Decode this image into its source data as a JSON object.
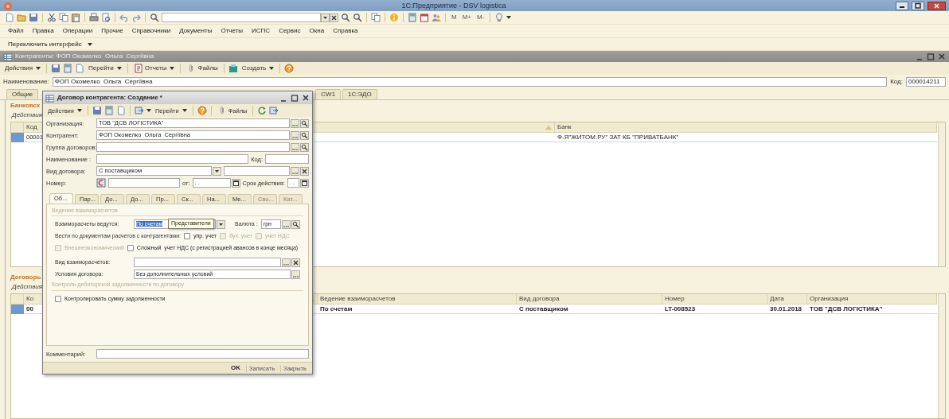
{
  "app_window": {
    "title": "1С:Предприятие - DSV logistica"
  },
  "memory_buttons": [
    "M",
    "M+",
    "M-"
  ],
  "menu": [
    "Файл",
    "Правка",
    "Операции",
    "Прочие",
    "Справочники",
    "Документы",
    "Отчеты",
    "ИСПС",
    "Сервис",
    "Окна",
    "Справка"
  ],
  "switch_interface": "Переключить интерфейс",
  "counterparty_window": {
    "title": "Контрагенты: ФОП Окомелко  Ольга  Сергіївна",
    "toolbar": [
      {
        "label": "Действия",
        "dropdown": true
      },
      {
        "label": "Перейти",
        "dropdown": true
      },
      {
        "label": "Отчеты",
        "dropdown": true
      },
      {
        "label": "Файлы",
        "dropdown": false
      },
      {
        "label": "Создать",
        "dropdown": true
      }
    ],
    "name_label": "Наименование:",
    "name_value": "ФОП Окомелко  Ольга  Сергіївна",
    "code_label": "Код:",
    "code_value": "000014211",
    "tabs": [
      {
        "label": "Общие",
        "selected": false
      },
      {
        "label": "CW1",
        "selected": false
      },
      {
        "label": "1С:ЭДО",
        "selected": false
      }
    ],
    "bank_section": {
      "title": "Банковск",
      "actions": "Действия",
      "columns": [
        "Код",
        "Банк"
      ],
      "rows": [
        {
          "code": "00001",
          "bank": "Ф-Я\"ЖИТОМ.РУ\" ЗАТ КБ \"ПРИВАТБАНК\"",
          "selected": true
        }
      ]
    },
    "contracts_section": {
      "title": "Договорь",
      "actions": "Действия",
      "columns": [
        "Ко",
        "Ведение взаиморасчетов",
        "Вид договора",
        "Номер",
        "Дата",
        "Организация"
      ],
      "rows": [
        {
          "cells": [
            "00",
            "По счетам",
            "С поставщиком",
            "LT-008523",
            "30.01.2018",
            "ТОВ \"ДСВ ЛОГІСТИКА\""
          ],
          "selected": true
        }
      ]
    }
  },
  "contract_dialog": {
    "title": "Договор контрагента: Создание *",
    "toolbar": [
      {
        "label": "Действия",
        "dropdown": true
      },
      {
        "label": "Перейти",
        "dropdown": true
      },
      {
        "label": "Файлы",
        "dropdown": false
      }
    ],
    "organization_label": "Организация:",
    "organization_value": "ТОВ \"ДСВ ЛОГІСТИКА\"",
    "counterparty_label": "Контрагент:",
    "counterparty_value": "ФОП Окомелко  Ольга  Сергіївна",
    "group_label": "Группа договоров:",
    "name_label": "Наименование :",
    "code_label": "Код:",
    "type_label": "Вид договора:",
    "type_value": "С поставщиком",
    "number_label": "Номер:",
    "date_label": "от:",
    "date_value": ". .",
    "term_label": "Срок действия:",
    "term_value": ". .",
    "tabs": [
      {
        "label": "Об...",
        "selected": true,
        "disabled": false
      },
      {
        "label": "Пар...",
        "selected": false,
        "disabled": false
      },
      {
        "label": "До...",
        "selected": false,
        "disabled": false
      },
      {
        "label": "До...",
        "selected": false,
        "disabled": false
      },
      {
        "label": "Пр...",
        "selected": false,
        "disabled": false
      },
      {
        "label": "Ск...",
        "selected": false,
        "disabled": false
      },
      {
        "label": "На...",
        "selected": false,
        "disabled": false
      },
      {
        "label": "Ме...",
        "selected": false,
        "disabled": false
      },
      {
        "label": "Сво...",
        "selected": false,
        "disabled": true
      },
      {
        "label": "Кат...",
        "selected": false,
        "disabled": true
      }
    ],
    "settlement_section": "Ведение взаиморасчетов",
    "settlement_label": "Взаиморасчеты ведутся:",
    "settlement_value": "По счетам",
    "tooltip": "Представители",
    "currency_label": "Валюта :",
    "currency_value": "грн",
    "documents_label": "Вести по документам расчетов с контрагентами:",
    "document_checkboxes": [
      {
        "label": "упр. учет",
        "checked": false,
        "disabled": false
      },
      {
        "label": "бух. учет",
        "checked": false,
        "disabled": true
      },
      {
        "label": "учет НДС",
        "checked": false,
        "disabled": true
      }
    ],
    "vat_checkboxes": [
      {
        "label": "Внешнеэкономический",
        "checked": false,
        "disabled": true
      },
      {
        "label": "Сложный  учет НДС (с регистрацией авансов в конце месяца)",
        "checked": false,
        "disabled": false
      }
    ],
    "settlement_kind_label": "Вид взаиморасчетов:",
    "terms_label": "Условия договора:",
    "terms_value": "Без дополнительных условий",
    "debt_section": "Контроль дебиторской задолженности по договору",
    "debt_checkbox": {
      "label": "Контролировать сумму задолженности",
      "checked": false,
      "disabled": false
    },
    "comment_label": "Комментарий:",
    "buttons": [
      "OK",
      "Записать",
      "Закрыть"
    ]
  }
}
